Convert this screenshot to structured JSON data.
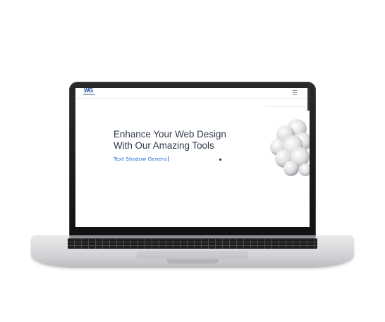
{
  "site": {
    "logo": "WG",
    "hero": {
      "line1": "Enhance Your Web Design",
      "line2": "With Our Amazing Tools"
    },
    "typed_text": "Text Shadow Genera",
    "menu_icon": "hamburger-menu-icon"
  },
  "colors": {
    "heading": "#2f3a4a",
    "accent": "#1e6fd9",
    "logo": "#1f4fa3",
    "bezel": "#1a1a1c",
    "chassis": "#d6d6d9"
  }
}
